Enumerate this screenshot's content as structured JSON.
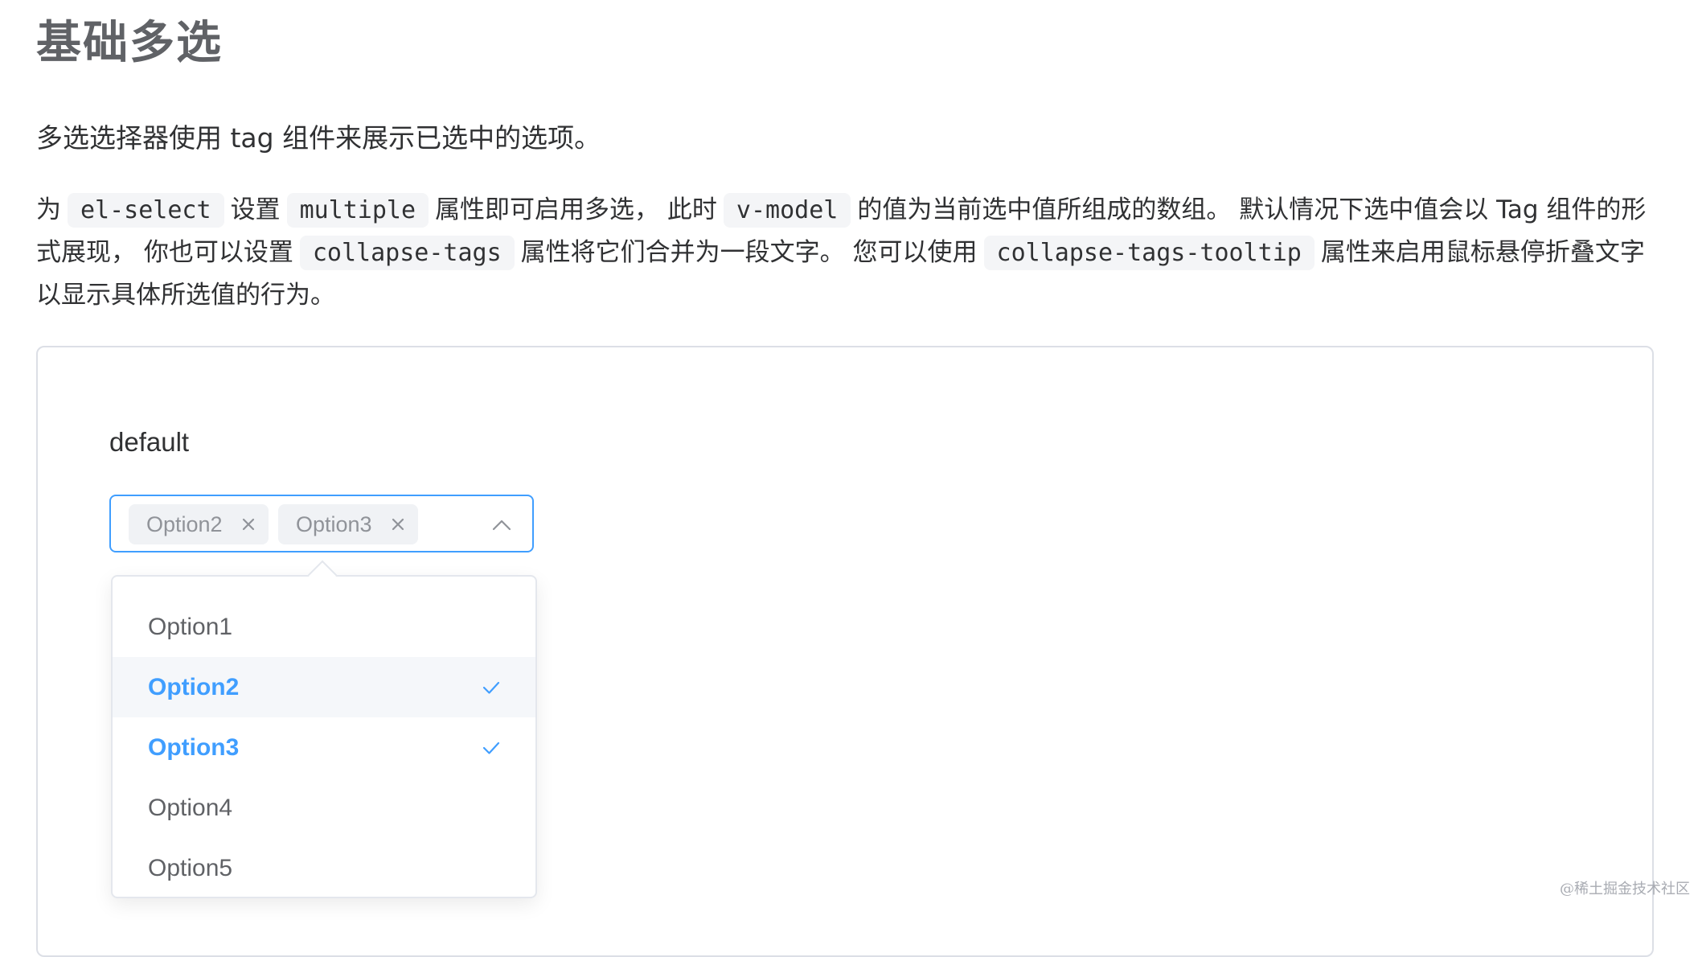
{
  "page": {
    "title": "基础多选",
    "intro": "多选选择器使用 tag 组件来展示已选中的选项。"
  },
  "description": {
    "text_1": "为",
    "code_1": "el-select",
    "text_2": "设置",
    "code_2": "multiple",
    "text_3": "属性即可启用多选， 此时",
    "code_3": "v-model",
    "text_4": "的值为当前选中值所组成的数组。 默认情况下选中值会以 Tag 组件的形式展现， 你也可以设置",
    "code_4": "collapse-tags",
    "text_5": "属性将它们合并为一段文字。 您可以使用",
    "code_5": "collapse-tags-tooltip",
    "text_6": "属性来启用鼠标悬停折叠文字以显示具体所选值的行为。"
  },
  "demo": {
    "label": "default",
    "select": {
      "tags": [
        "Option2",
        "Option3"
      ],
      "tag_close_icon": "close-icon",
      "arrow_icon": "chevron-up-icon",
      "state": "open"
    },
    "dropdown": {
      "options": [
        {
          "label": "Option1",
          "selected": false
        },
        {
          "label": "Option2",
          "selected": true
        },
        {
          "label": "Option3",
          "selected": true
        },
        {
          "label": "Option4",
          "selected": false
        },
        {
          "label": "Option5",
          "selected": false
        }
      ],
      "check_icon": "check-icon"
    }
  },
  "watermark": "@稀土掘金技术社区",
  "colors": {
    "accent": "#409eff",
    "border": "#dcdfe6",
    "tag_bg": "#f0f2f5",
    "code_bg": "#f4f5f7",
    "hover_bg": "#f5f7fa",
    "text_primary": "#303133",
    "text_regular": "#606266",
    "text_secondary": "#909399"
  }
}
